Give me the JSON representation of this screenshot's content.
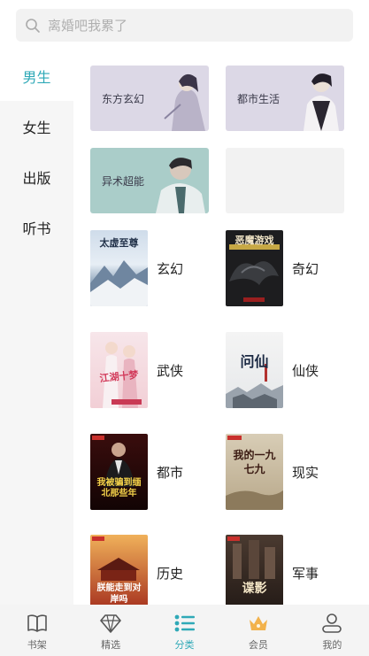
{
  "search": {
    "placeholder": "离婚吧我累了"
  },
  "sidebar": {
    "items": [
      {
        "label": "男生",
        "active": true
      },
      {
        "label": "女生",
        "active": false
      },
      {
        "label": "出版",
        "active": false
      },
      {
        "label": "听书",
        "active": false
      }
    ]
  },
  "banners": [
    {
      "label": "东方玄幻"
    },
    {
      "label": "都市生活"
    },
    {
      "label": "异术超能"
    }
  ],
  "categories": [
    {
      "label": "玄幻",
      "cover_title": "太虚至尊"
    },
    {
      "label": "奇幻",
      "cover_title": "恶魔游戏"
    },
    {
      "label": "武侠",
      "cover_title": "江湖十梦"
    },
    {
      "label": "仙侠",
      "cover_title": "问仙"
    },
    {
      "label": "都市",
      "cover_title": "我被骗到缅北那些年"
    },
    {
      "label": "现实",
      "cover_title": "我的一九七九"
    },
    {
      "label": "历史",
      "cover_title": "朕能走到对岸吗"
    },
    {
      "label": "军事",
      "cover_title": "谍影"
    }
  ],
  "tabbar": {
    "items": [
      {
        "label": "书架",
        "icon": "book-icon"
      },
      {
        "label": "精选",
        "icon": "diamond-icon"
      },
      {
        "label": "分类",
        "icon": "list-icon",
        "active": true
      },
      {
        "label": "会员",
        "icon": "crown-icon"
      },
      {
        "label": "我的",
        "icon": "person-icon"
      }
    ]
  },
  "colors": {
    "accent": "#2fa9b7",
    "crown": "#f2b24c"
  }
}
